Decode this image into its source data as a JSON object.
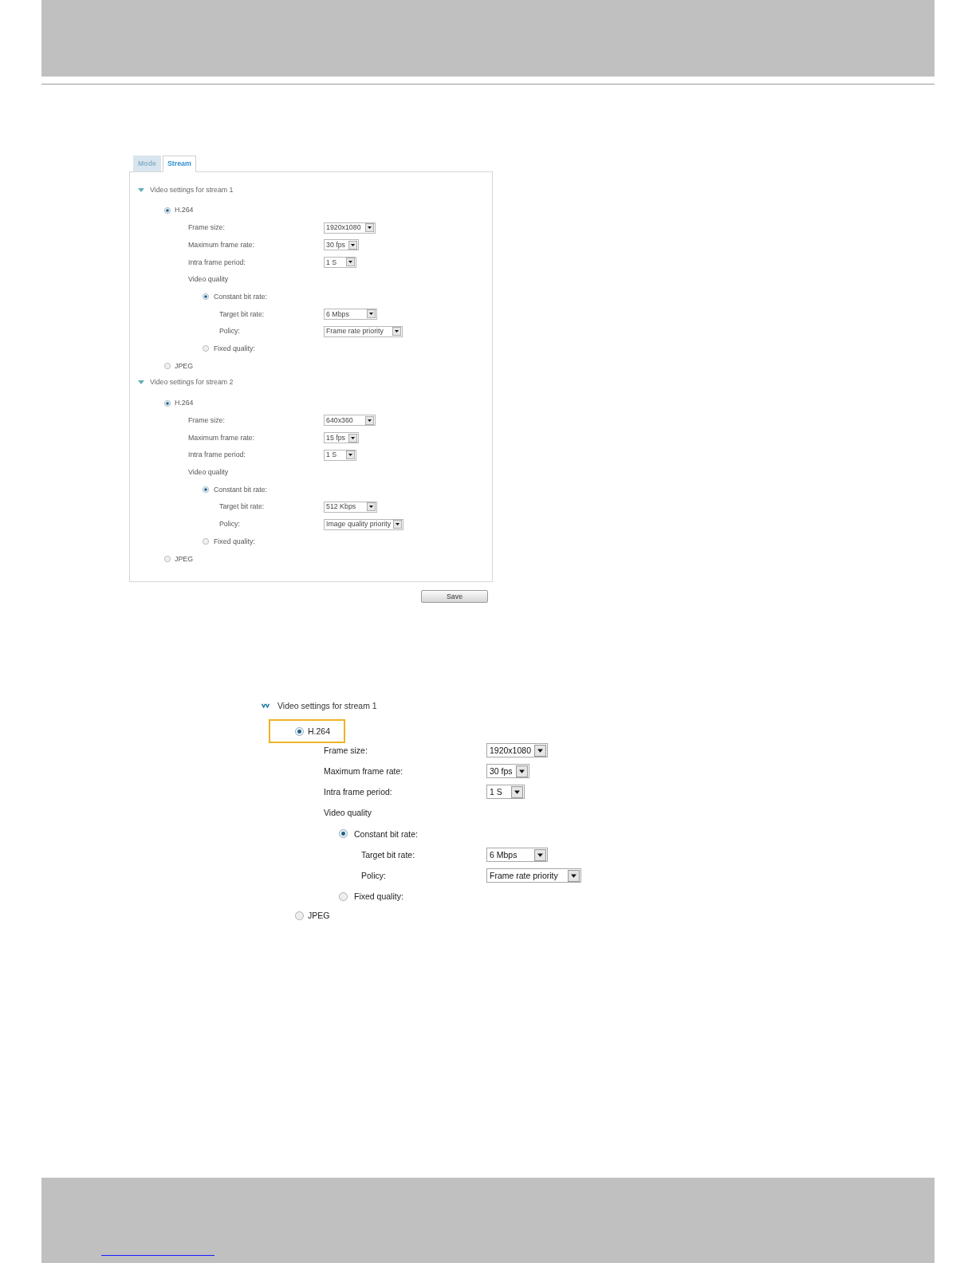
{
  "panel": {
    "tabs": [
      {
        "label": "Mode",
        "selected": false
      },
      {
        "label": "Stream",
        "selected": true
      }
    ],
    "streams": [
      {
        "title": "Video settings for stream 1",
        "expanded": true,
        "codecs": [
          {
            "label": "H.264",
            "selected": true,
            "settings": [
              {
                "label": "Frame size:",
                "value": "1920x1080"
              },
              {
                "label": "Maximum frame rate:",
                "value": "30 fps"
              },
              {
                "label": "Intra frame period:",
                "value": "1 S"
              }
            ],
            "quality": {
              "label": "Video quality",
              "modes": [
                {
                  "label": "Constant bit rate:",
                  "selected": true,
                  "settings": [
                    {
                      "label": "Target bit rate:",
                      "value": "6 Mbps"
                    },
                    {
                      "label": "Policy:",
                      "value": "Frame rate priority"
                    }
                  ]
                },
                {
                  "label": "Fixed quality:",
                  "selected": false
                }
              ]
            }
          },
          {
            "label": "JPEG",
            "selected": false
          }
        ]
      },
      {
        "title": "Video settings for stream 2",
        "expanded": true,
        "codecs": [
          {
            "label": "H.264",
            "selected": true,
            "settings": [
              {
                "label": "Frame size:",
                "value": "640x360"
              },
              {
                "label": "Maximum frame rate:",
                "value": "15 fps"
              },
              {
                "label": "Intra frame period:",
                "value": "1 S"
              }
            ],
            "quality": {
              "label": "Video quality",
              "modes": [
                {
                  "label": "Constant bit rate:",
                  "selected": true,
                  "settings": [
                    {
                      "label": "Target bit rate:",
                      "value": "512 Kbps"
                    },
                    {
                      "label": "Policy:",
                      "value": "Image quality priority"
                    }
                  ]
                },
                {
                  "label": "Fixed quality:",
                  "selected": false
                }
              ]
            }
          },
          {
            "label": "JPEG",
            "selected": false
          }
        ]
      }
    ],
    "save_button": "Save"
  },
  "detail": {
    "title": "Video settings for stream 1",
    "expanded": true,
    "codecs": [
      {
        "label": "H.264",
        "selected": true,
        "highlighted": true,
        "settings": [
          {
            "label": "Frame size:",
            "value": "1920x1080"
          },
          {
            "label": "Maximum frame rate:",
            "value": "30 fps"
          },
          {
            "label": "Intra frame period:",
            "value": "1 S"
          }
        ],
        "quality": {
          "label": "Video quality",
          "modes": [
            {
              "label": "Constant bit rate:",
              "selected": true,
              "settings": [
                {
                  "label": "Target bit rate:",
                  "value": "6 Mbps"
                },
                {
                  "label": "Policy:",
                  "value": "Frame rate priority"
                }
              ]
            },
            {
              "label": "Fixed quality:",
              "selected": false
            }
          ]
        }
      },
      {
        "label": "JPEG",
        "selected": false,
        "highlighted": false
      }
    ]
  }
}
